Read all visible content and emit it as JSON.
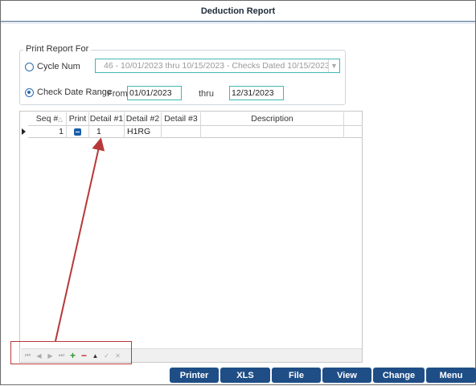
{
  "window": {
    "title": "Deduction Report"
  },
  "print_report_for": {
    "legend": "Print Report For",
    "cycle_num_label": "Cycle Num",
    "cycle_num_value": "46 - 10/01/2023 thru 10/15/2023 -  Checks Dated 10/15/2023",
    "check_date_range_label": "Check Date Range",
    "from_label": "From",
    "from_value": "01/01/2023",
    "thru_label": "thru",
    "thru_value": "12/31/2023",
    "selected": "check_date_range"
  },
  "grid": {
    "columns": [
      "Seq #",
      "Print",
      "Detail #1",
      "Detail #2",
      "Detail #3",
      "Description"
    ],
    "rows": [
      {
        "seq": "1",
        "detail1": "1",
        "detail2": "H1RG",
        "detail3": "",
        "description": ""
      }
    ],
    "sort_icon": "sort-arrow-icon"
  },
  "navigator": {
    "icons": [
      "first-icon",
      "prev-icon",
      "next-icon",
      "last-icon",
      "add-icon",
      "delete-icon",
      "edit-icon",
      "post-icon",
      "cancel-icon"
    ]
  },
  "annotation": {
    "color": "#b73838"
  },
  "buttons": {
    "printer": "Printer",
    "xls": "XLS",
    "file": "File",
    "view": "View",
    "change": "Change",
    "menu": "Menu"
  },
  "colors": {
    "accent": "#41b7b4",
    "button_bg": "#1f4e86",
    "radio": "#2c6cb0"
  }
}
